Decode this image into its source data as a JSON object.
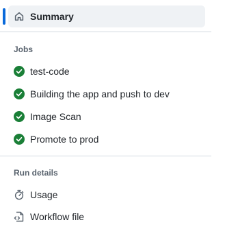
{
  "summary": {
    "label": "Summary",
    "icon": "home-icon"
  },
  "jobs": {
    "title": "Jobs",
    "items": [
      {
        "label": "test-code",
        "status": "success",
        "icon": "check-circle-fill-icon"
      },
      {
        "label": "Building the app and push to dev",
        "status": "success",
        "icon": "check-circle-fill-icon"
      },
      {
        "label": "Image Scan",
        "status": "success",
        "icon": "check-circle-fill-icon"
      },
      {
        "label": "Promote to prod",
        "status": "success",
        "icon": "check-circle-fill-icon"
      }
    ]
  },
  "run_details": {
    "title": "Run details",
    "items": [
      {
        "label": "Usage",
        "icon": "stopwatch-icon"
      },
      {
        "label": "Workflow file",
        "icon": "file-code-icon"
      }
    ]
  },
  "colors": {
    "accent": "#0969da",
    "success": "#1a7f37",
    "muted": "#59636e",
    "selected_bg": "#eff2f5",
    "divider": "#d1d9e0"
  }
}
